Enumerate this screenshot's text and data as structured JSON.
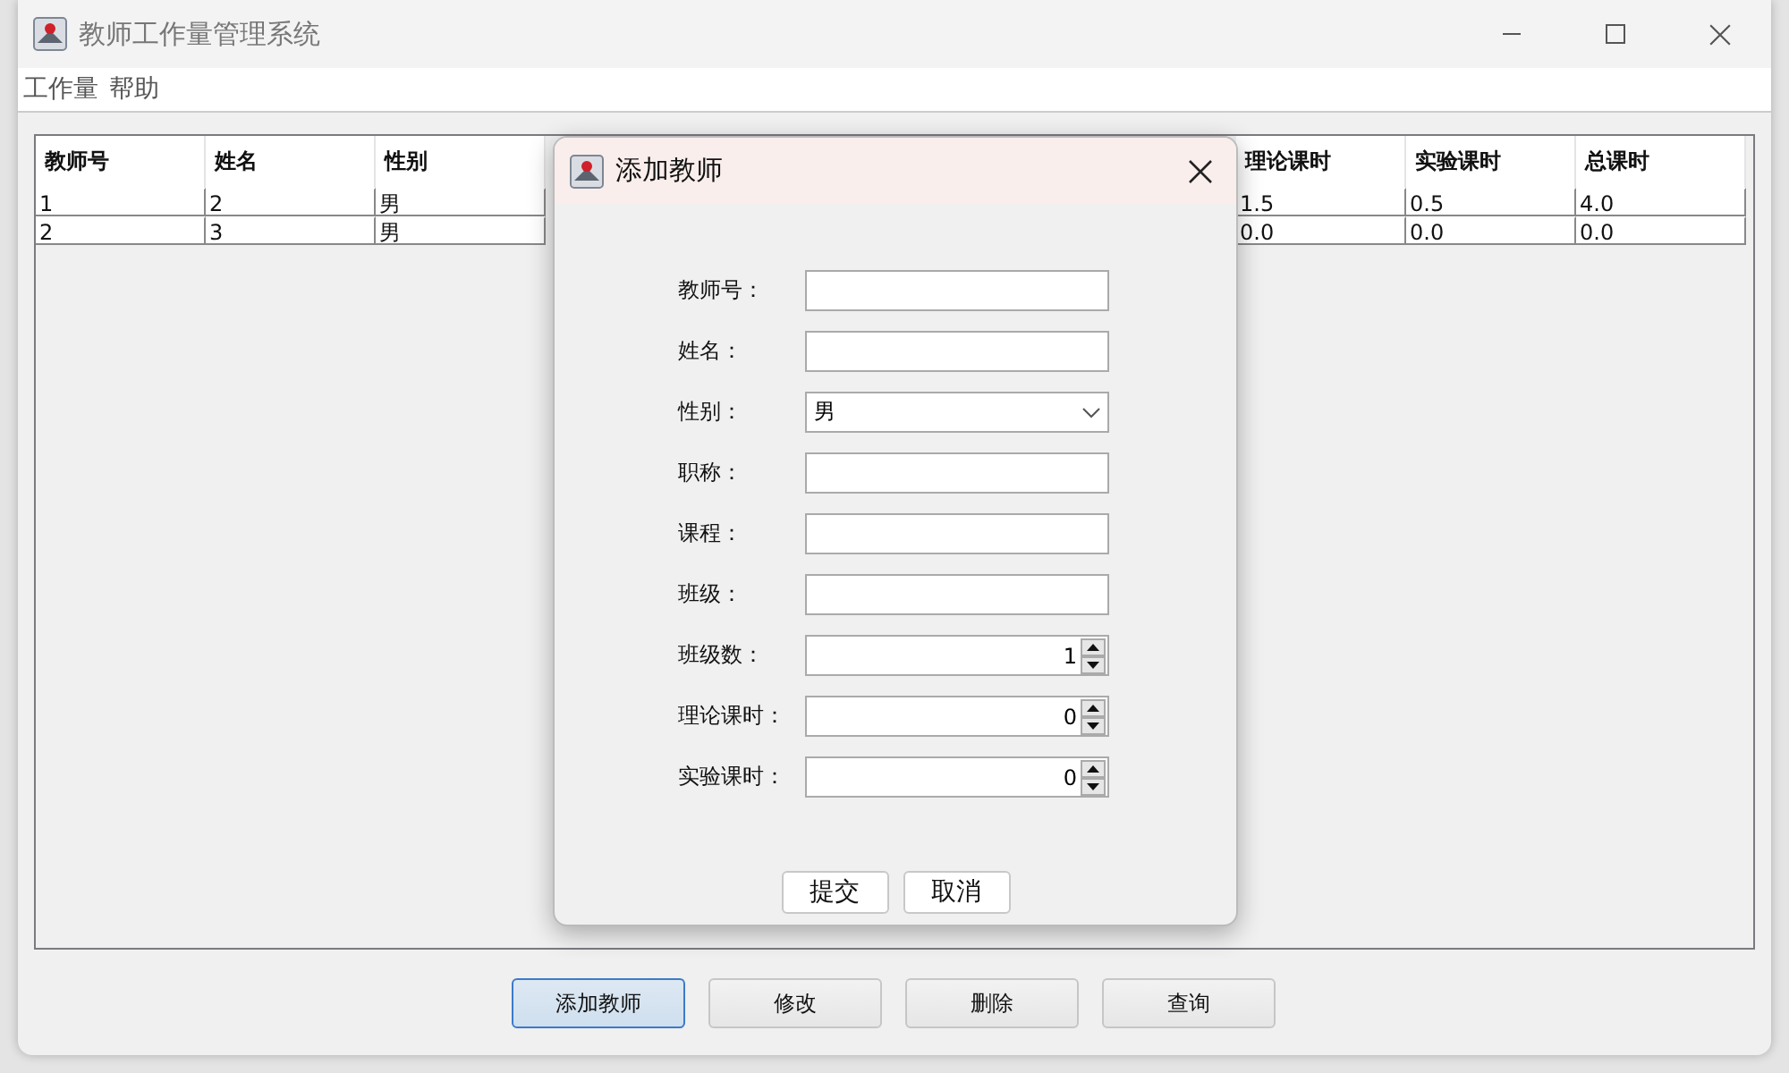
{
  "window": {
    "title": "教师工作量管理系统"
  },
  "menu": [
    {
      "label": "工作量"
    },
    {
      "label": "帮助"
    }
  ],
  "table": {
    "columns": [
      "教师号",
      "姓名",
      "性别",
      "理论课时",
      "实验课时",
      "总课时"
    ],
    "rows": [
      {
        "cells": [
          "1",
          "2",
          "男",
          "1.5",
          "0.5",
          "4.0"
        ]
      },
      {
        "cells": [
          "2",
          "3",
          "男",
          "0.0",
          "0.0",
          "0.0"
        ]
      }
    ]
  },
  "buttons": [
    {
      "label": "添加教师",
      "focused": true
    },
    {
      "label": "修改",
      "focused": false
    },
    {
      "label": "删除",
      "focused": false
    },
    {
      "label": "查询",
      "focused": false
    }
  ],
  "dialog": {
    "title": "添加教师",
    "fields": [
      {
        "label": "教师号：",
        "kind": "text"
      },
      {
        "label": "姓名：",
        "kind": "text"
      },
      {
        "label": "性别：",
        "kind": "select",
        "value": "男"
      },
      {
        "label": "职称：",
        "kind": "text"
      },
      {
        "label": "课程：",
        "kind": "text"
      },
      {
        "label": "班级：",
        "kind": "text"
      },
      {
        "label": "班级数：",
        "kind": "spinner",
        "value": "1"
      },
      {
        "label": "理论课时：",
        "kind": "spinner",
        "value": "0"
      },
      {
        "label": "实验课时：",
        "kind": "spinner",
        "value": "0"
      }
    ],
    "buttons": [
      {
        "label": "提交"
      },
      {
        "label": "取消"
      }
    ]
  }
}
